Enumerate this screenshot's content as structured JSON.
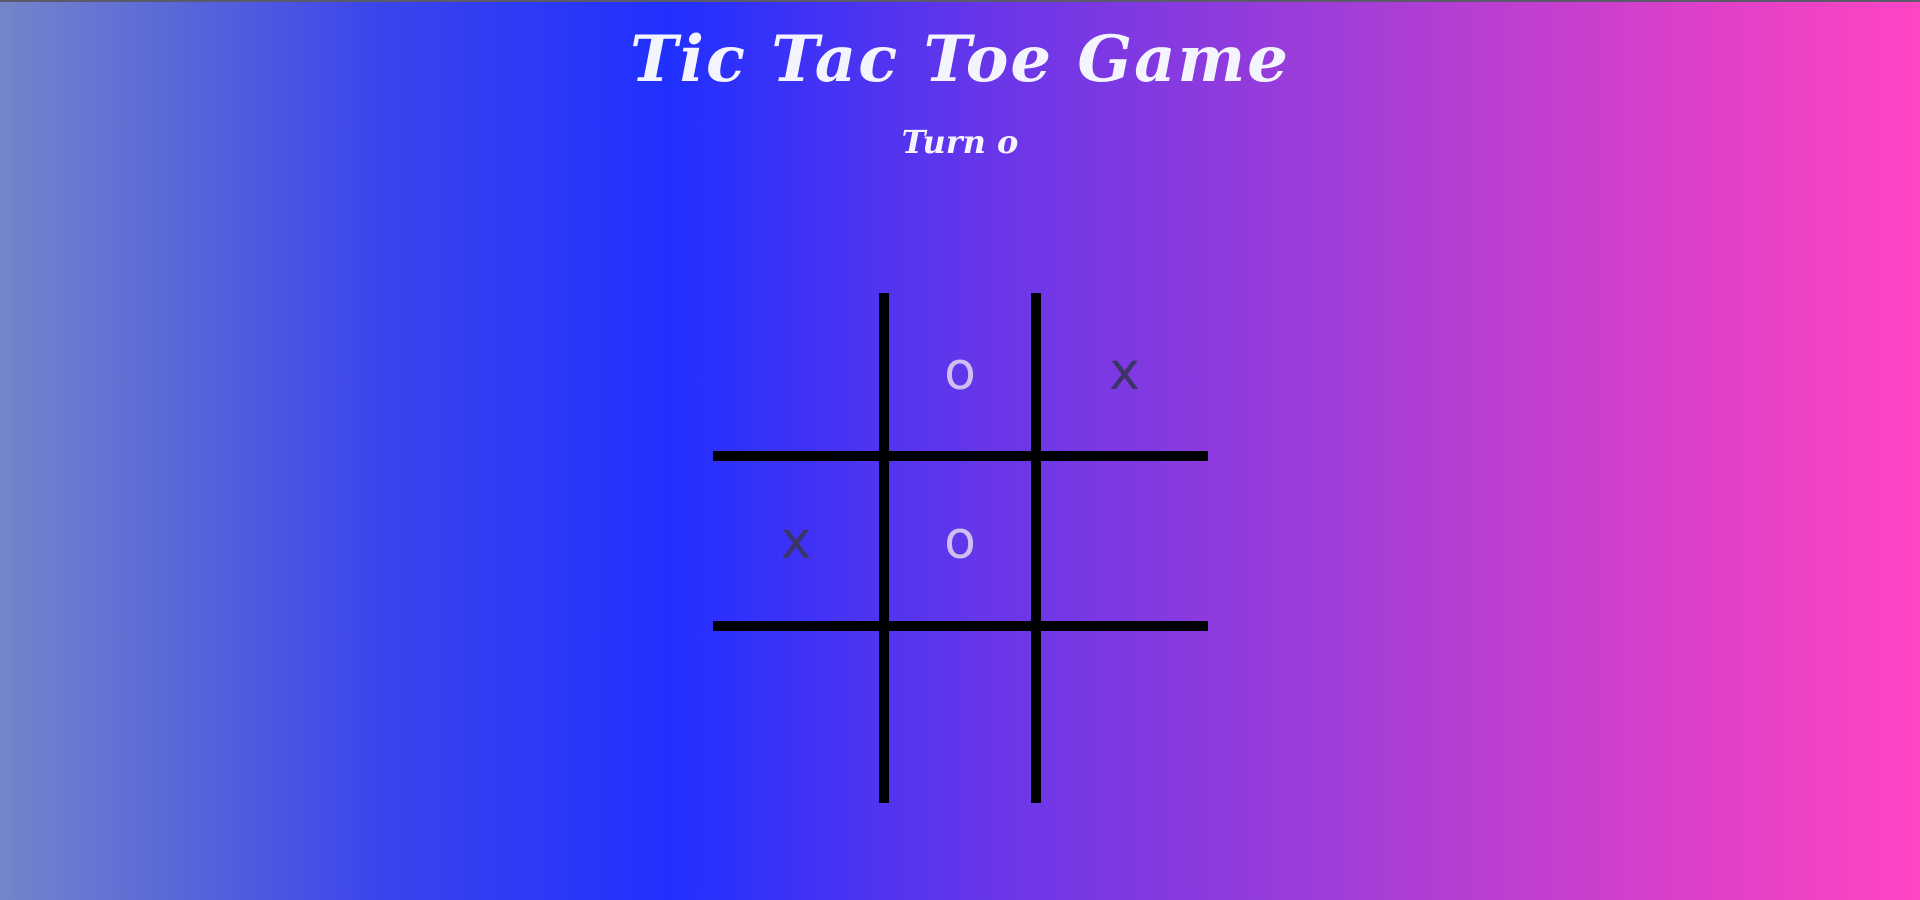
{
  "game": {
    "title": "Tic Tac Toe Game",
    "turn_text": "Turn o"
  },
  "board": {
    "cells": [
      {
        "mark": ""
      },
      {
        "mark": "o"
      },
      {
        "mark": "x"
      },
      {
        "mark": "x"
      },
      {
        "mark": "o"
      },
      {
        "mark": ""
      },
      {
        "mark": ""
      },
      {
        "mark": ""
      },
      {
        "mark": ""
      }
    ]
  },
  "colors": {
    "x_mark": "#3a3566",
    "o_mark": "#cdbff0",
    "grid_lines": "#000000",
    "title_text": "#f4f4ff"
  }
}
